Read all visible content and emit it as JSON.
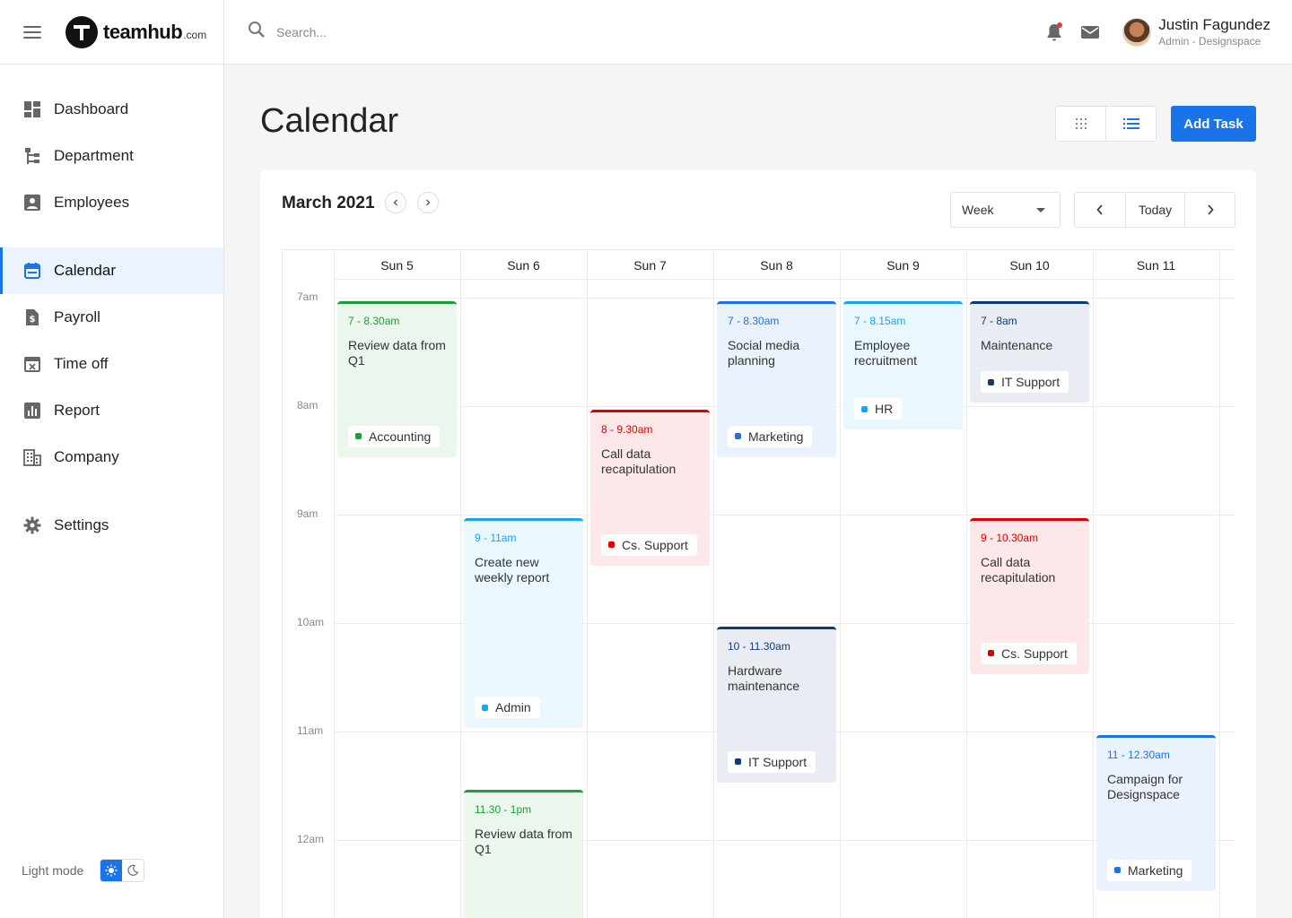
{
  "brand": {
    "name": "teamhub",
    "suffix": ".com"
  },
  "search": {
    "placeholder": "Search..."
  },
  "user": {
    "name": "Justin Fagundez",
    "role": "Admin - Designspace"
  },
  "sidebar": {
    "items": [
      {
        "label": "Dashboard",
        "icon": "dashboard-icon"
      },
      {
        "label": "Department",
        "icon": "department-icon"
      },
      {
        "label": "Employees",
        "icon": "employees-icon"
      },
      {
        "label": "Calendar",
        "icon": "calendar-icon",
        "active": true
      },
      {
        "label": "Payroll",
        "icon": "payroll-icon"
      },
      {
        "label": "Time off",
        "icon": "time-off-icon"
      },
      {
        "label": "Report",
        "icon": "report-icon"
      },
      {
        "label": "Company",
        "icon": "company-icon"
      },
      {
        "label": "Settings",
        "icon": "settings-icon"
      }
    ],
    "mode_label": "Light mode"
  },
  "page": {
    "title": "Calendar",
    "add_task": "Add Task"
  },
  "calendar": {
    "month": "March 2021",
    "view": "Week",
    "today": "Today",
    "days": [
      "Sun 5",
      "Sun 6",
      "Sun 7",
      "Sun 8",
      "Sun 9",
      "Sun 10",
      "Sun 11"
    ],
    "times": [
      "7am",
      "8am",
      "9am",
      "10am",
      "11am",
      "12am"
    ],
    "events": [
      {
        "time": "7 - 8.30am",
        "title": "Review data from Q1",
        "tag": "Accounting",
        "day": "Sun 5",
        "color": "#1e9e3a"
      },
      {
        "time": "9 - 11am",
        "title": "Create new weekly report",
        "tag": "Admin",
        "day": "Sun 6",
        "color": "#1aa3f0"
      },
      {
        "time": "11.30 - 1pm",
        "title": "Review data from Q1",
        "tag": "",
        "day": "Sun 6",
        "color": "#1e9e3a"
      },
      {
        "time": "8 - 9.30am",
        "title": "Call data recapitulation",
        "tag": "Cs. Support",
        "day": "Sun 7",
        "color": "#e00000"
      },
      {
        "time": "7 - 8.30am",
        "title": "Social media planning",
        "tag": "Marketing",
        "day": "Sun 8",
        "color": "#1a73e8"
      },
      {
        "time": "10 - 11.30am",
        "title": "Hardware maintenance",
        "tag": "IT Support",
        "day": "Sun 8",
        "color": "#0d3a7a"
      },
      {
        "time": "7 - 8.15am",
        "title": "Employee recruitment",
        "tag": "HR",
        "day": "Sun 9",
        "color": "#1aa3f0"
      },
      {
        "time": "7 - 8am",
        "title": "Maintenance",
        "tag": "IT Support",
        "day": "Sun 10",
        "color": "#0d3a7a"
      },
      {
        "time": "9 - 10.30am",
        "title": "Call data recapitulation",
        "tag": "Cs. Support",
        "day": "Sun 10",
        "color": "#e00000"
      },
      {
        "time": "11 - 12.30am",
        "title": "Campaign for Designspace",
        "tag": "Marketing",
        "day": "Sun 11",
        "color": "#1a73e8"
      }
    ]
  }
}
